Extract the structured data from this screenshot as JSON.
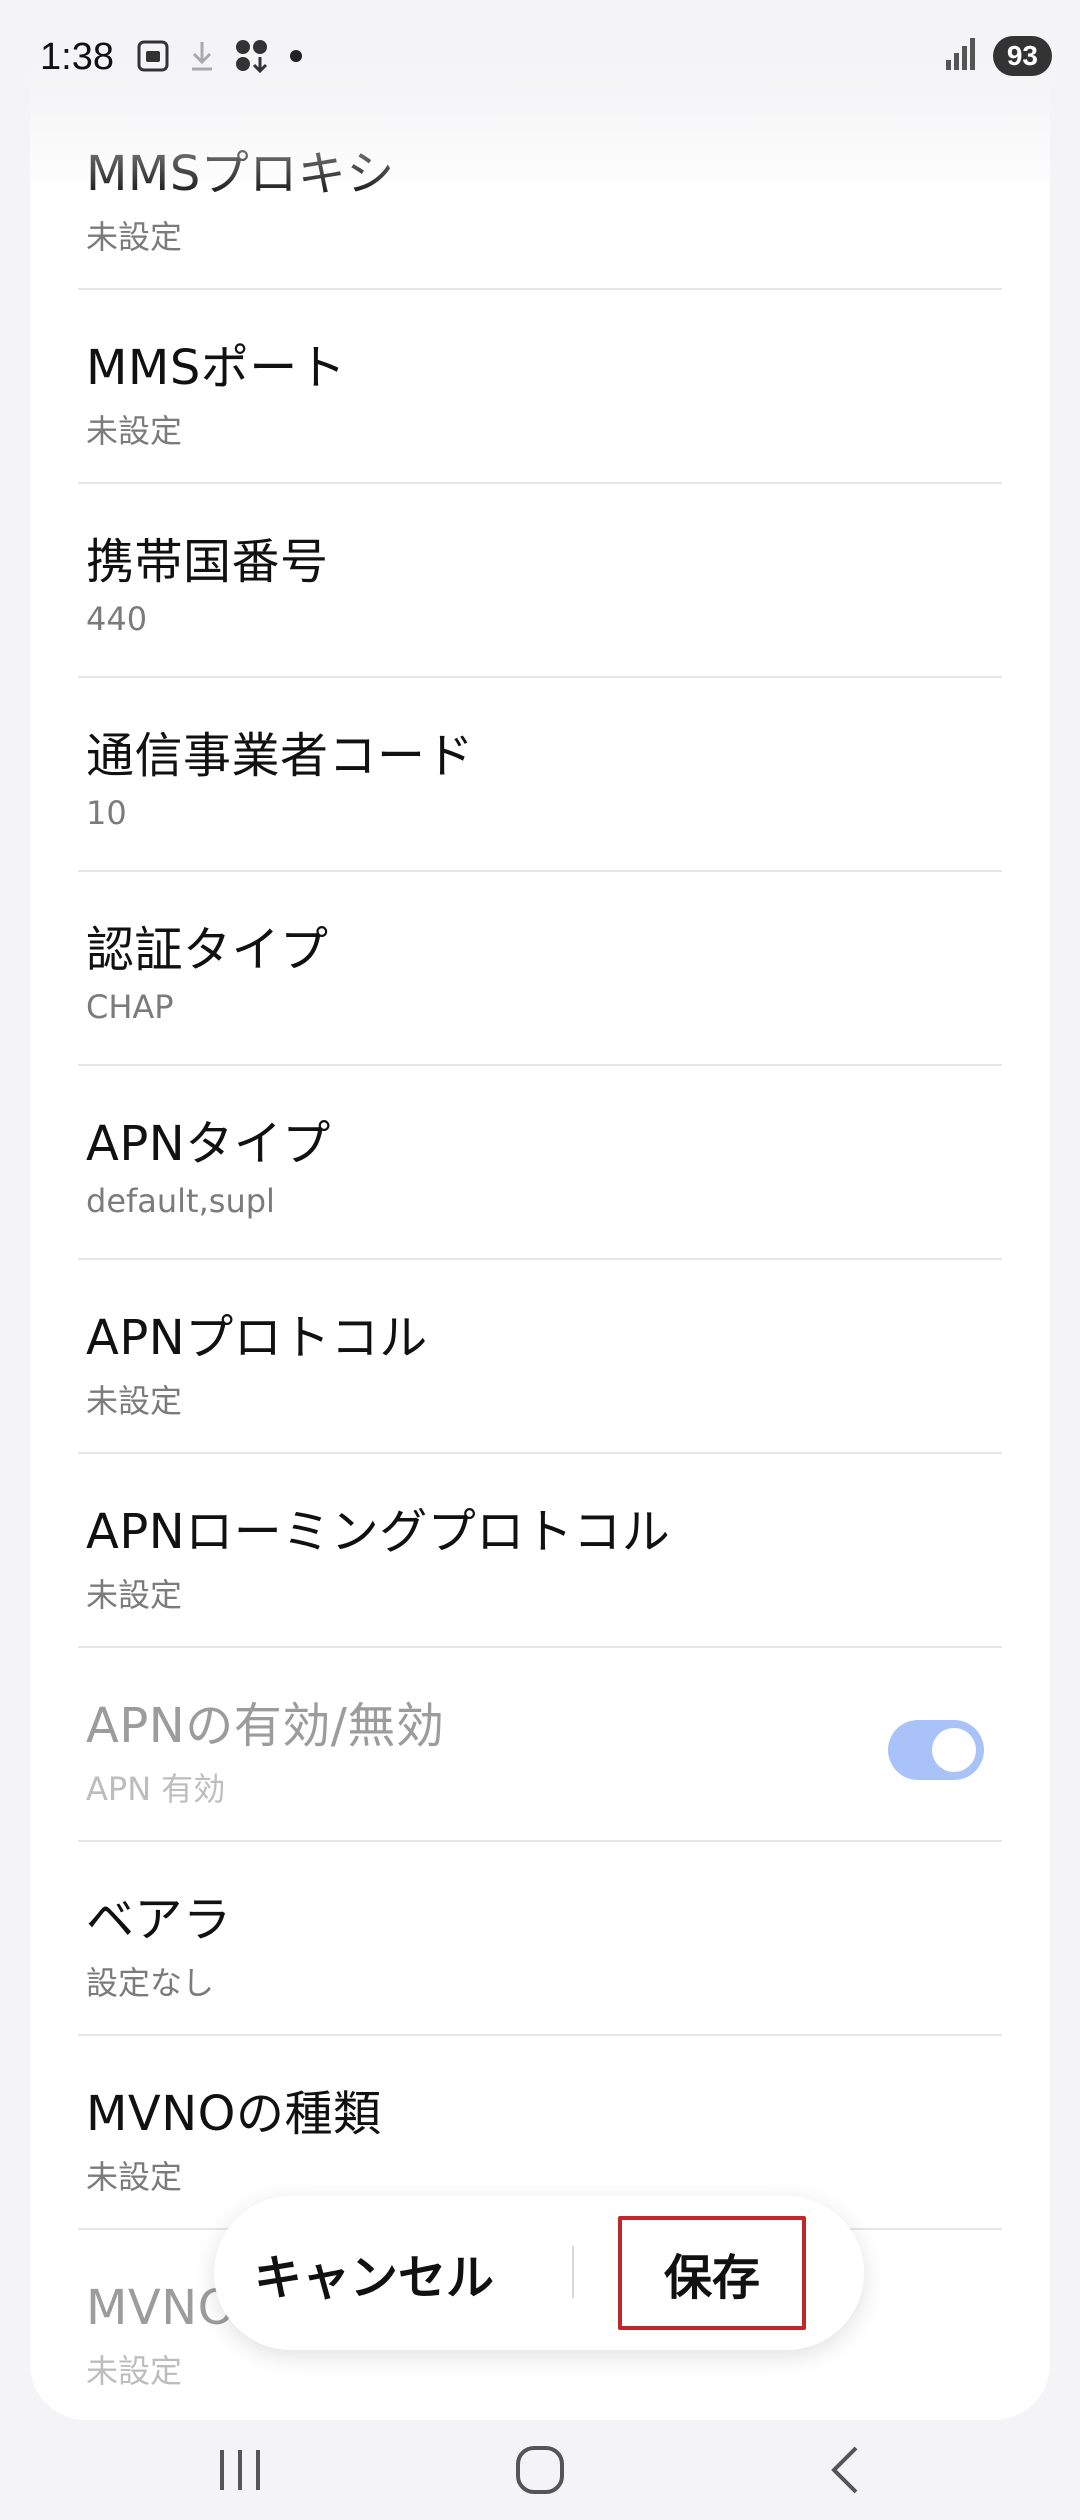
{
  "status_bar": {
    "time": "1:38",
    "battery": "93",
    "icons": [
      "screenshot-icon",
      "download-icon",
      "apps-icon",
      "dot-icon",
      "signal-icon"
    ]
  },
  "partial_top_text": "未設定",
  "settings": [
    {
      "title": "MMSプロキシ",
      "value": "未設定"
    },
    {
      "title": "MMSポート",
      "value": "未設定"
    },
    {
      "title": "携帯国番号",
      "value": "440"
    },
    {
      "title": "通信事業者コード",
      "value": "10"
    },
    {
      "title": "認証タイプ",
      "value": "CHAP"
    },
    {
      "title": "APNタイプ",
      "value": "default,supl"
    },
    {
      "title": "APNプロトコル",
      "value": "未設定"
    },
    {
      "title": "APNローミングプロトコル",
      "value": "未設定"
    },
    {
      "title": "APNの有効/無効",
      "value": "APN 有効",
      "toggle_on": true,
      "disabled": true
    },
    {
      "title": "ベアラ",
      "value": "設定なし"
    },
    {
      "title": "MVNOの種類",
      "value": "未設定"
    },
    {
      "title": "MVNO値",
      "value": "未設定"
    }
  ],
  "actions": {
    "cancel_label": "キャンセル",
    "save_label": "保存"
  },
  "colors": {
    "toggle_track": "#a9c3f8",
    "save_highlight": "#c0272d"
  }
}
